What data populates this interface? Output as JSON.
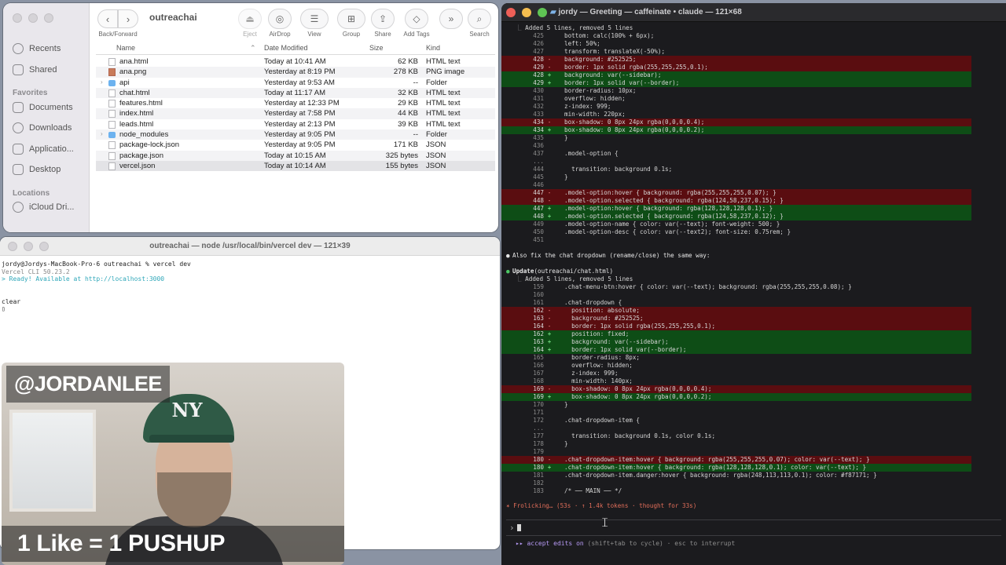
{
  "finder": {
    "title": "outreachai",
    "toolbar": {
      "back_forward_label": "Back/Forward",
      "eject": "Eject",
      "airdrop": "AirDrop",
      "view": "View",
      "group": "Group",
      "share": "Share",
      "add_tags": "Add Tags",
      "search": "Search"
    },
    "sidebar": {
      "items_top": [
        "Recents",
        "Shared"
      ],
      "favorites_heading": "Favorites",
      "favorites": [
        "Documents",
        "Downloads",
        "Applicatio...",
        "Desktop"
      ],
      "locations_heading": "Locations",
      "locations": [
        "iCloud Dri..."
      ]
    },
    "columns": {
      "name": "Name",
      "date": "Date Modified",
      "size": "Size",
      "kind": "Kind"
    },
    "files": [
      {
        "name": "ana.html",
        "date": "Today at 10:41 AM",
        "size": "62 KB",
        "kind": "HTML text",
        "icon": "doc"
      },
      {
        "name": "ana.png",
        "date": "Yesterday at 8:19 PM",
        "size": "278 KB",
        "kind": "PNG image",
        "icon": "img"
      },
      {
        "name": "api",
        "date": "Yesterday at 9:53 AM",
        "size": "--",
        "kind": "Folder",
        "icon": "folder"
      },
      {
        "name": "chat.html",
        "date": "Today at 11:17 AM",
        "size": "32 KB",
        "kind": "HTML text",
        "icon": "doc"
      },
      {
        "name": "features.html",
        "date": "Yesterday at 12:33 PM",
        "size": "29 KB",
        "kind": "HTML text",
        "icon": "doc"
      },
      {
        "name": "index.html",
        "date": "Yesterday at 7:58 PM",
        "size": "44 KB",
        "kind": "HTML text",
        "icon": "doc"
      },
      {
        "name": "leads.html",
        "date": "Yesterday at 2:13 PM",
        "size": "39 KB",
        "kind": "HTML text",
        "icon": "doc"
      },
      {
        "name": "node_modules",
        "date": "Yesterday at 9:05 PM",
        "size": "--",
        "kind": "Folder",
        "icon": "folder"
      },
      {
        "name": "package-lock.json",
        "date": "Yesterday at 9:05 PM",
        "size": "171 KB",
        "kind": "JSON",
        "icon": "doc"
      },
      {
        "name": "package.json",
        "date": "Today at 10:15 AM",
        "size": "325 bytes",
        "kind": "JSON",
        "icon": "doc"
      },
      {
        "name": "vercel.json",
        "date": "Today at 10:14 AM",
        "size": "155 bytes",
        "kind": "JSON",
        "icon": "doc"
      }
    ]
  },
  "vercel_terminal": {
    "title": "outreachai — node /usr/local/bin/vercel dev — 121×39",
    "lines": [
      {
        "text": "jordy@Jordys-MacBook-Pro-6 outreachai % vercel dev",
        "style": ""
      },
      {
        "text": "Vercel CLI 50.23.2",
        "style": "vgray"
      },
      {
        "text": "> Ready! Available at http://localhost:3000",
        "style": "vcyan"
      },
      {
        "text": "",
        "style": ""
      },
      {
        "text": "",
        "style": ""
      },
      {
        "text": "clear",
        "style": ""
      },
      {
        "text": "▯",
        "style": ""
      }
    ]
  },
  "webcam": {
    "handle": "@JORDANLEE",
    "caption": "1 Like = 1 PUSHUP",
    "cap_logo": "NY"
  },
  "claude_terminal": {
    "title": "jordy — Greeting — caffeinate • claude — 121×68",
    "diff1_summary": "Added 5 lines, removed 5 lines",
    "diff1": [
      {
        "t": "ctx",
        "n": "425",
        "c": "bottom: calc(100% + 6px);"
      },
      {
        "t": "ctx",
        "n": "426",
        "c": "left: 50%;"
      },
      {
        "t": "ctx",
        "n": "427",
        "c": "transform: translateX(-50%);"
      },
      {
        "t": "del",
        "n": "428",
        "c": "background: #252525;"
      },
      {
        "t": "del",
        "n": "429",
        "c": "border: 1px solid rgba(255,255,255,0.1);"
      },
      {
        "t": "add",
        "n": "428",
        "c": "background: var(--sidebar);"
      },
      {
        "t": "add",
        "n": "429",
        "c": "border: 1px solid var(--border);"
      },
      {
        "t": "ctx",
        "n": "430",
        "c": "border-radius: 10px;"
      },
      {
        "t": "ctx",
        "n": "431",
        "c": "overflow: hidden;"
      },
      {
        "t": "ctx",
        "n": "432",
        "c": "z-index: 999;"
      },
      {
        "t": "ctx",
        "n": "433",
        "c": "min-width: 220px;"
      },
      {
        "t": "del",
        "n": "434",
        "c": "box-shadow: 0 8px 24px rgba(0,0,0,0.4);"
      },
      {
        "t": "add",
        "n": "434",
        "c": "box-shadow: 0 8px 24px rgba(0,0,0,0.2);"
      },
      {
        "t": "ctx",
        "n": "435",
        "c": "}"
      },
      {
        "t": "ctx",
        "n": "436",
        "c": ""
      },
      {
        "t": "ctx",
        "n": "437",
        "c": ".model-option {"
      },
      {
        "t": "gap",
        "n": "...",
        "c": ""
      },
      {
        "t": "ctx",
        "n": "444",
        "c": "  transition: background 0.1s;"
      },
      {
        "t": "ctx",
        "n": "445",
        "c": "}"
      },
      {
        "t": "ctx",
        "n": "446",
        "c": ""
      },
      {
        "t": "del",
        "n": "447",
        "c": ".model-option:hover { background: rgba(255,255,255,0.07); }"
      },
      {
        "t": "del",
        "n": "448",
        "c": ".model-option.selected { background: rgba(124,58,237,0.15); }"
      },
      {
        "t": "add",
        "n": "447",
        "c": ".model-option:hover { background: rgba(128,128,128,0.1); }"
      },
      {
        "t": "add",
        "n": "448",
        "c": ".model-option.selected { background: rgba(124,58,237,0.12); }"
      },
      {
        "t": "ctx",
        "n": "449",
        "c": ".model-option-name { color: var(--text); font-weight: 500; }"
      },
      {
        "t": "ctx",
        "n": "450",
        "c": ".model-option-desc { color: var(--text2); font-size: 0.75rem; }"
      },
      {
        "t": "ctx",
        "n": "451",
        "c": ""
      }
    ],
    "message": "Also fix the chat dropdown (rename/close) the same way:",
    "update_tool": "Update",
    "update_target": "(outreachai/chat.html)",
    "diff2_summary": "Added 5 lines, removed 5 lines",
    "diff2": [
      {
        "t": "ctx",
        "n": "159",
        "c": ".chat-menu-btn:hover { color: var(--text); background: rgba(255,255,255,0.08); }"
      },
      {
        "t": "ctx",
        "n": "160",
        "c": ""
      },
      {
        "t": "ctx",
        "n": "161",
        "c": ".chat-dropdown {"
      },
      {
        "t": "del",
        "n": "162",
        "c": "  position: absolute;"
      },
      {
        "t": "del",
        "n": "163",
        "c": "  background: #252525;"
      },
      {
        "t": "del",
        "n": "164",
        "c": "  border: 1px solid rgba(255,255,255,0.1);"
      },
      {
        "t": "add",
        "n": "162",
        "c": "  position: fixed;"
      },
      {
        "t": "add",
        "n": "163",
        "c": "  background: var(--sidebar);"
      },
      {
        "t": "add",
        "n": "164",
        "c": "  border: 1px solid var(--border);"
      },
      {
        "t": "ctx",
        "n": "165",
        "c": "  border-radius: 8px;"
      },
      {
        "t": "ctx",
        "n": "166",
        "c": "  overflow: hidden;"
      },
      {
        "t": "ctx",
        "n": "167",
        "c": "  z-index: 999;"
      },
      {
        "t": "ctx",
        "n": "168",
        "c": "  min-width: 140px;"
      },
      {
        "t": "del",
        "n": "169",
        "c": "  box-shadow: 0 8px 24px rgba(0,0,0,0.4);"
      },
      {
        "t": "add",
        "n": "169",
        "c": "  box-shadow: 0 8px 24px rgba(0,0,0,0.2);"
      },
      {
        "t": "ctx",
        "n": "170",
        "c": "}"
      },
      {
        "t": "ctx",
        "n": "171",
        "c": ""
      },
      {
        "t": "ctx",
        "n": "172",
        "c": ".chat-dropdown-item {"
      },
      {
        "t": "gap",
        "n": "...",
        "c": ""
      },
      {
        "t": "ctx",
        "n": "177",
        "c": "  transition: background 0.1s, color 0.1s;"
      },
      {
        "t": "ctx",
        "n": "178",
        "c": "}"
      },
      {
        "t": "ctx",
        "n": "179",
        "c": ""
      },
      {
        "t": "del",
        "n": "180",
        "c": ".chat-dropdown-item:hover { background: rgba(255,255,255,0.07); color: var(--text); }"
      },
      {
        "t": "add",
        "n": "180",
        "c": ".chat-dropdown-item:hover { background: rgba(128,128,128,0.1); color: var(--text); }"
      },
      {
        "t": "ctx",
        "n": "181",
        "c": ".chat-dropdown-item.danger:hover { background: rgba(248,113,113,0.1); color: #f87171; }"
      },
      {
        "t": "ctx",
        "n": "182",
        "c": ""
      },
      {
        "t": "ctx",
        "n": "183",
        "c": "/* ── MAIN ── */"
      }
    ],
    "status": "✶ Frolicking… (53s · ↑ 1.4k tokens · thought for 33s)",
    "prompt_symbol": "›",
    "hint_accent": "▸▸ accept edits on",
    "hint_rest": " (shift+tab to cycle) · esc to interrupt"
  }
}
